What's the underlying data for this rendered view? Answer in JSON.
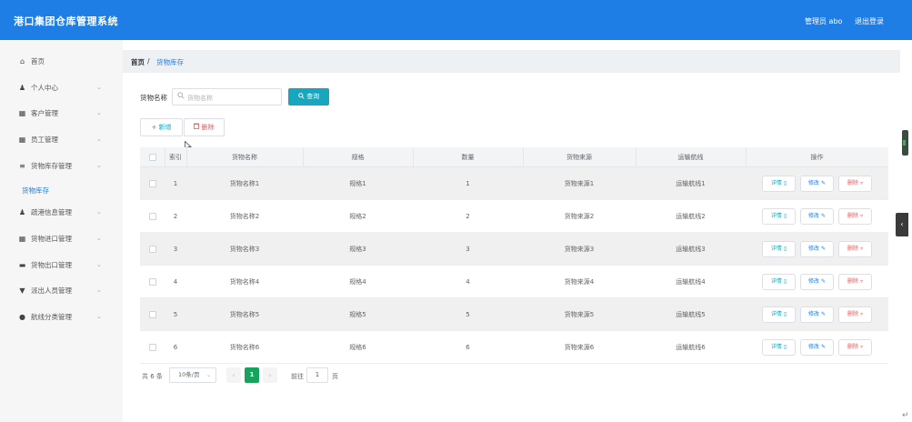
{
  "header": {
    "title": "港口集团仓库管理系统",
    "admin_label": "管理员 abo",
    "logout_label": "退出登录"
  },
  "sidebar": {
    "items": [
      {
        "label": "首页",
        "icon": "home-icon",
        "glyph": "⌂"
      },
      {
        "label": "个人中心",
        "icon": "user-icon",
        "glyph": "♟"
      },
      {
        "label": "客户管理",
        "icon": "grid-icon",
        "glyph": "▦"
      },
      {
        "label": "员工管理",
        "icon": "grid-icon",
        "glyph": "▦"
      },
      {
        "label": "货物库存管理",
        "icon": "list-icon",
        "glyph": "≡"
      },
      {
        "label": "疏港信息管理",
        "icon": "user-icon",
        "glyph": "♟"
      },
      {
        "label": "货物进口管理",
        "icon": "grid-icon",
        "glyph": "▦"
      },
      {
        "label": "货物出口管理",
        "icon": "ship-icon",
        "glyph": "▬"
      },
      {
        "label": "派出人员管理",
        "icon": "shield-icon",
        "glyph": "▼"
      },
      {
        "label": "航线分类管理",
        "icon": "location-icon",
        "glyph": "●"
      }
    ],
    "sub_item": "货物库存",
    "arrow": "⌄"
  },
  "breadcrumb": {
    "home": "首页",
    "separator": "/",
    "current": "货物库存"
  },
  "search": {
    "label": "货物名称",
    "placeholder": "货物名称",
    "button_label": "查询"
  },
  "toolbar": {
    "add_label": "新增",
    "delete_label": "删除"
  },
  "table": {
    "headers": [
      "索引",
      "货物名称",
      "规格",
      "数量",
      "货物来源",
      "运输航线",
      "操作"
    ],
    "rows": [
      {
        "index": "1",
        "name": "货物名称1",
        "spec": "规格1",
        "quantity": "1",
        "source": "货物来源1",
        "route": "运输航线1"
      },
      {
        "index": "2",
        "name": "货物名称2",
        "spec": "规格2",
        "quantity": "2",
        "source": "货物来源2",
        "route": "运输航线2"
      },
      {
        "index": "3",
        "name": "货物名称3",
        "spec": "规格3",
        "quantity": "3",
        "source": "货物来源3",
        "route": "运输航线3"
      },
      {
        "index": "4",
        "name": "货物名称4",
        "spec": "规格4",
        "quantity": "4",
        "source": "货物来源4",
        "route": "运输航线4"
      },
      {
        "index": "5",
        "name": "货物名称5",
        "spec": "规格5",
        "quantity": "5",
        "source": "货物来源5",
        "route": "运输航线5"
      },
      {
        "index": "6",
        "name": "货物名称6",
        "spec": "规格6",
        "quantity": "6",
        "source": "货物来源6",
        "route": "运输航线6"
      }
    ],
    "actions": {
      "detail": "详情",
      "edit": "修改",
      "delete": "删除"
    }
  },
  "pagination": {
    "total": "共 6 条",
    "page_size": "10条/页",
    "current_page": "1",
    "goto_label": "前往",
    "goto_value": "1",
    "unit": "页"
  },
  "colors": {
    "header": "#1f7de6",
    "primary": "#17a6bd",
    "danger": "#e05a5a",
    "pagination_active": "#17a35d"
  }
}
